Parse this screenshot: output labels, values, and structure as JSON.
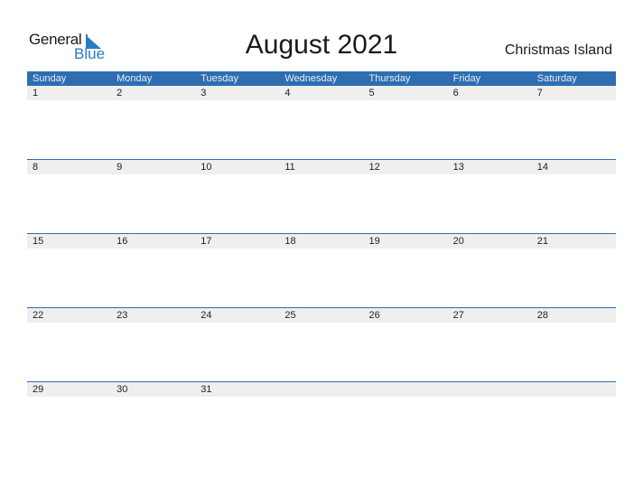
{
  "logo": {
    "line1": "General",
    "line2": "Blue"
  },
  "title": "August 2021",
  "region": "Christmas Island",
  "weekdays": [
    "Sunday",
    "Monday",
    "Tuesday",
    "Wednesday",
    "Thursday",
    "Friday",
    "Saturday"
  ],
  "weeks": [
    [
      "1",
      "2",
      "3",
      "4",
      "5",
      "6",
      "7"
    ],
    [
      "8",
      "9",
      "10",
      "11",
      "12",
      "13",
      "14"
    ],
    [
      "15",
      "16",
      "17",
      "18",
      "19",
      "20",
      "21"
    ],
    [
      "22",
      "23",
      "24",
      "25",
      "26",
      "27",
      "28"
    ],
    [
      "29",
      "30",
      "31",
      "",
      "",
      "",
      ""
    ]
  ],
  "colors": {
    "header": "#2e6eb0",
    "brand_blue": "#2a7bc4",
    "day_row": "#efefef"
  }
}
